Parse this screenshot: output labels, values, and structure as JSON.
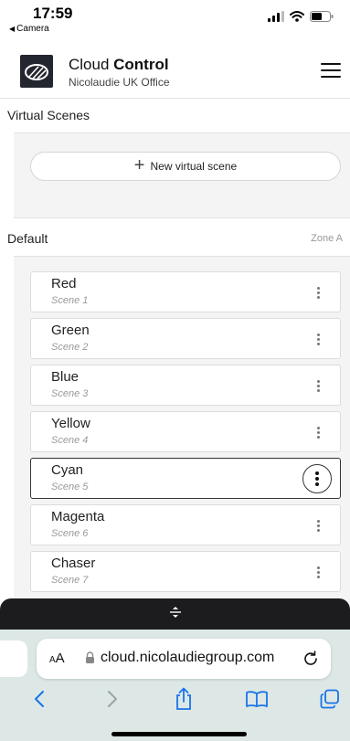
{
  "status": {
    "time": "17:59",
    "back_label": "Camera"
  },
  "header": {
    "title_light": "Cloud ",
    "title_bold": "Control",
    "subtitle": "Nicolaudie UK Office"
  },
  "virtual": {
    "label": "Virtual Scenes",
    "new_button": "New virtual scene"
  },
  "group": {
    "name": "Default",
    "zone": "Zone A"
  },
  "scenes": [
    {
      "name": "Red",
      "number": "Scene 1"
    },
    {
      "name": "Green",
      "number": "Scene 2"
    },
    {
      "name": "Blue",
      "number": "Scene 3"
    },
    {
      "name": "Yellow",
      "number": "Scene 4"
    },
    {
      "name": "Cyan",
      "number": "Scene 5",
      "active": true
    },
    {
      "name": "Magenta",
      "number": "Scene 6"
    },
    {
      "name": "Chaser",
      "number": "Scene 7"
    }
  ],
  "browser": {
    "aa_small": "A",
    "aa_large": "A",
    "url": "cloud.nicolaudiegroup.com"
  },
  "colors": {
    "accent": "#1a73e8",
    "toolbar": "#dde8e6",
    "dark_strip": "#1c1c1e"
  }
}
